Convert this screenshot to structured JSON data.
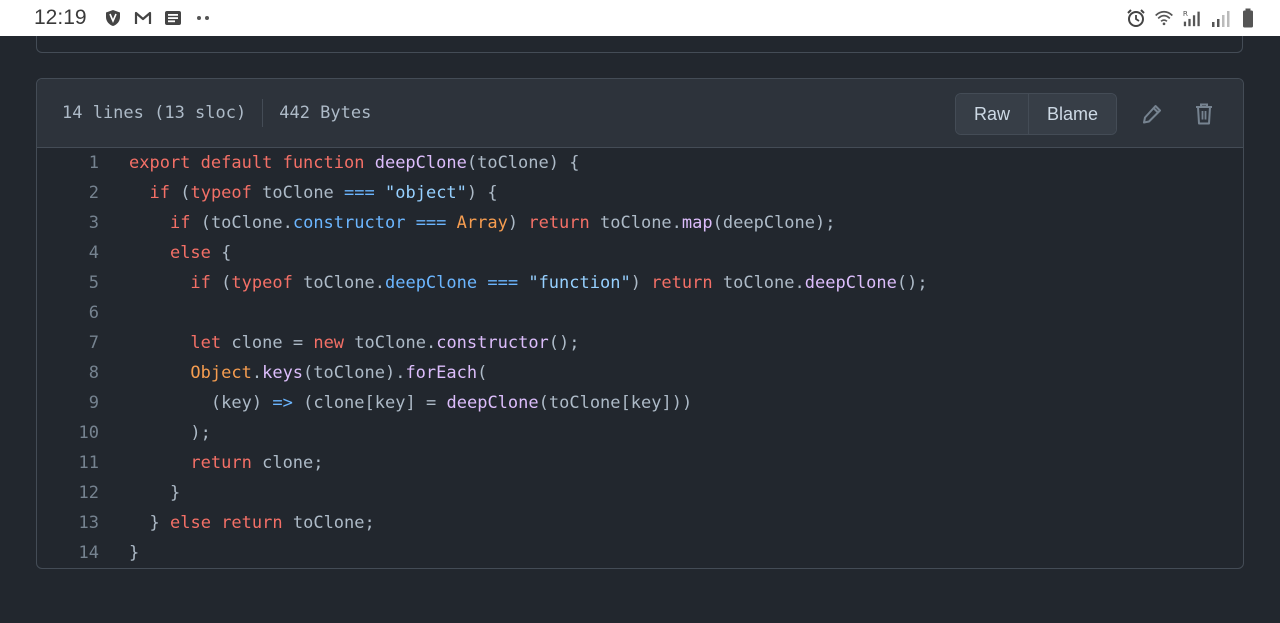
{
  "statusbar": {
    "time": "12:19",
    "left_icons": [
      "shield-icon",
      "gmail-icon",
      "news-icon",
      "more-dots-icon"
    ],
    "right_icons": [
      "alarm-icon",
      "wifi-icon",
      "signal-r-icon",
      "signal-icon",
      "battery-icon"
    ]
  },
  "file": {
    "lines_info": "14 lines (13 sloc)",
    "size": "442 Bytes",
    "raw_label": "Raw",
    "blame_label": "Blame",
    "edit_icon": "pencil-icon",
    "delete_icon": "trash-icon"
  },
  "code": {
    "line_numbers": [
      "1",
      "2",
      "3",
      "4",
      "5",
      "6",
      "7",
      "8",
      "9",
      "10",
      "11",
      "12",
      "13",
      "14"
    ],
    "lines": [
      "export default function deepClone(toClone) {",
      "  if (typeof toClone === \"object\") {",
      "    if (toClone.constructor === Array) return toClone.map(deepClone);",
      "    else {",
      "      if (typeof toClone.deepClone === \"function\") return toClone.deepClone();",
      "",
      "      let clone = new toClone.constructor();",
      "      Object.keys(toClone).forEach(",
      "        (key) => (clone[key] = deepClone(toClone[key]))",
      "      );",
      "      return clone;",
      "    }",
      "  } else return toClone;",
      "}"
    ]
  },
  "colors": {
    "background": "#22272e",
    "header": "#2d333b",
    "keyword": "#f47067",
    "function": "#dcbdfb",
    "constant": "#6cb6ff",
    "string": "#96d0ff",
    "builtin": "#f69d50"
  }
}
